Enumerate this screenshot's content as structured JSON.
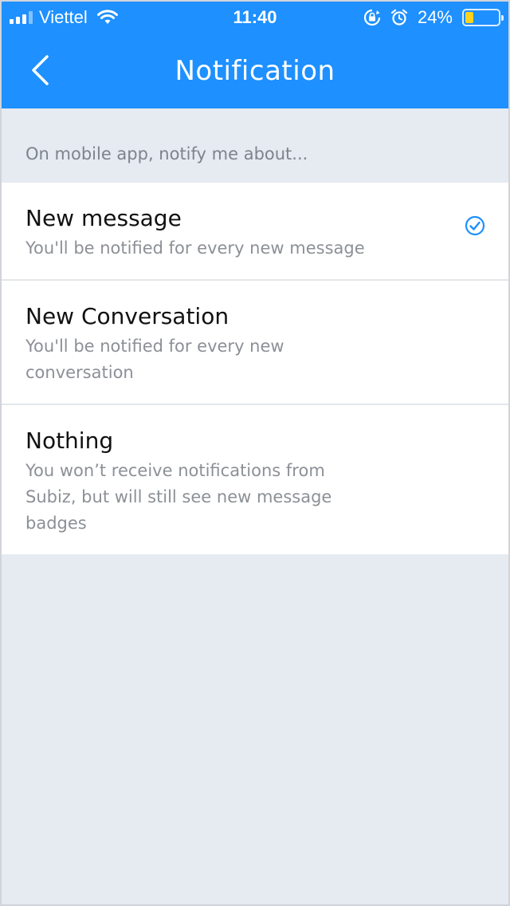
{
  "status_bar": {
    "carrier": "Viettel",
    "time": "11:40",
    "battery_percent": "24%",
    "battery_level": 0.24,
    "icons": [
      "signal-icon",
      "wifi-icon",
      "rotation-lock-icon",
      "alarm-icon",
      "battery-icon"
    ]
  },
  "nav": {
    "title": "Notification",
    "back_icon": "chevron-left-icon"
  },
  "section": {
    "header": "On mobile app, notify me about..."
  },
  "options": [
    {
      "title": "New message",
      "description": "You'll be notified for every new message",
      "selected": true
    },
    {
      "title": "New Conversation",
      "description": "You'll be notified for every new conversation",
      "selected": false
    },
    {
      "title": "Nothing",
      "description": "You won’t receive notifications from Subiz, but will still see new message badges",
      "selected": false
    }
  ],
  "colors": {
    "header_bg": "#1e90ff",
    "page_bg": "#e6eaf1",
    "accent": "#1e90ff",
    "battery_fill": "#ffd21f"
  }
}
